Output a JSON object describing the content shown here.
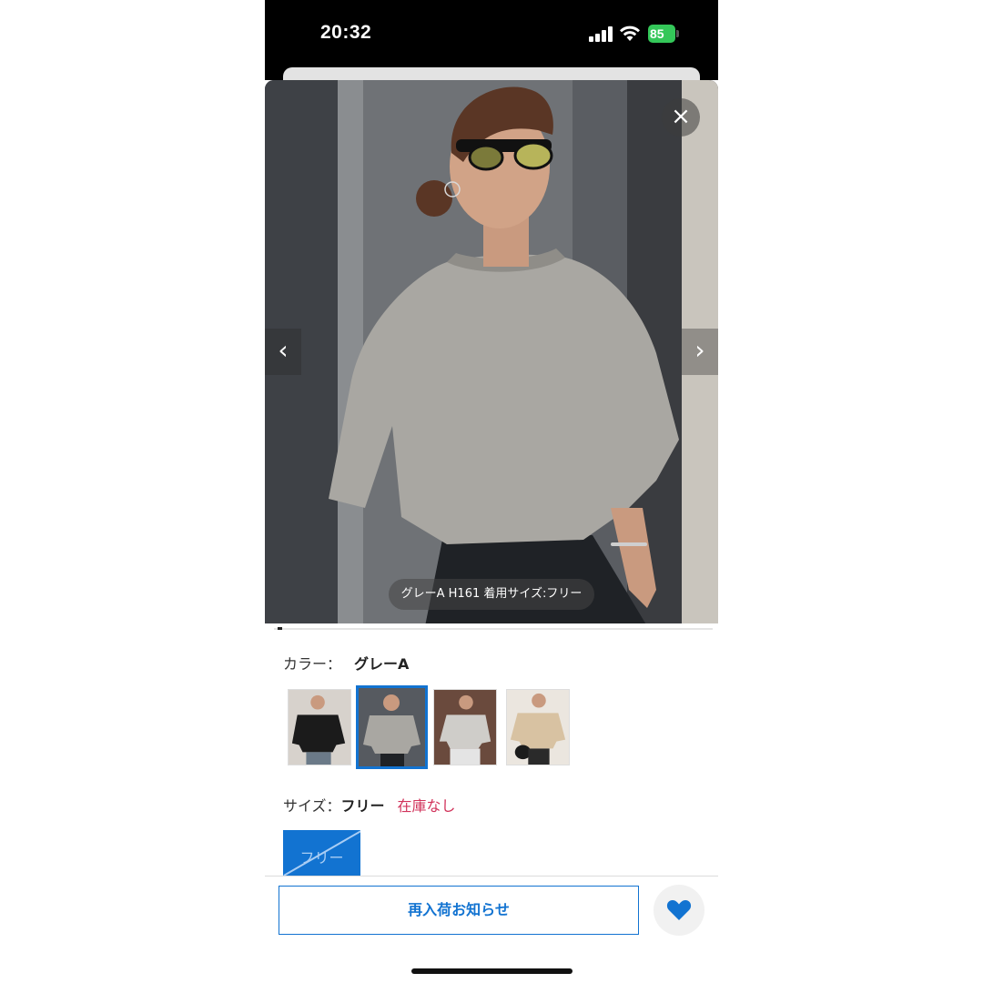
{
  "status_bar": {
    "time": "20:32",
    "battery": "85"
  },
  "gallery": {
    "caption": "グレーA H161 着用サイズ:フリー",
    "close_symbol": "×",
    "prev_symbol": "‹",
    "next_symbol": "›",
    "slide_index": 2,
    "slide_count": 30
  },
  "color": {
    "label": "カラー：",
    "selected": "グレーA",
    "swatches": [
      "black",
      "gray-a",
      "gray-b",
      "beige"
    ],
    "selected_index": 1
  },
  "size": {
    "label": "サイズ：",
    "selected": "フリー",
    "stock_status": "在庫なし",
    "options": [
      "フリー"
    ]
  },
  "actions": {
    "restock_label": "再入荷お知らせ",
    "favorite_icon": "heart-icon"
  },
  "colors": {
    "accent": "#1273d1",
    "stock_warning": "#d1335b",
    "battery": "#34c759"
  }
}
